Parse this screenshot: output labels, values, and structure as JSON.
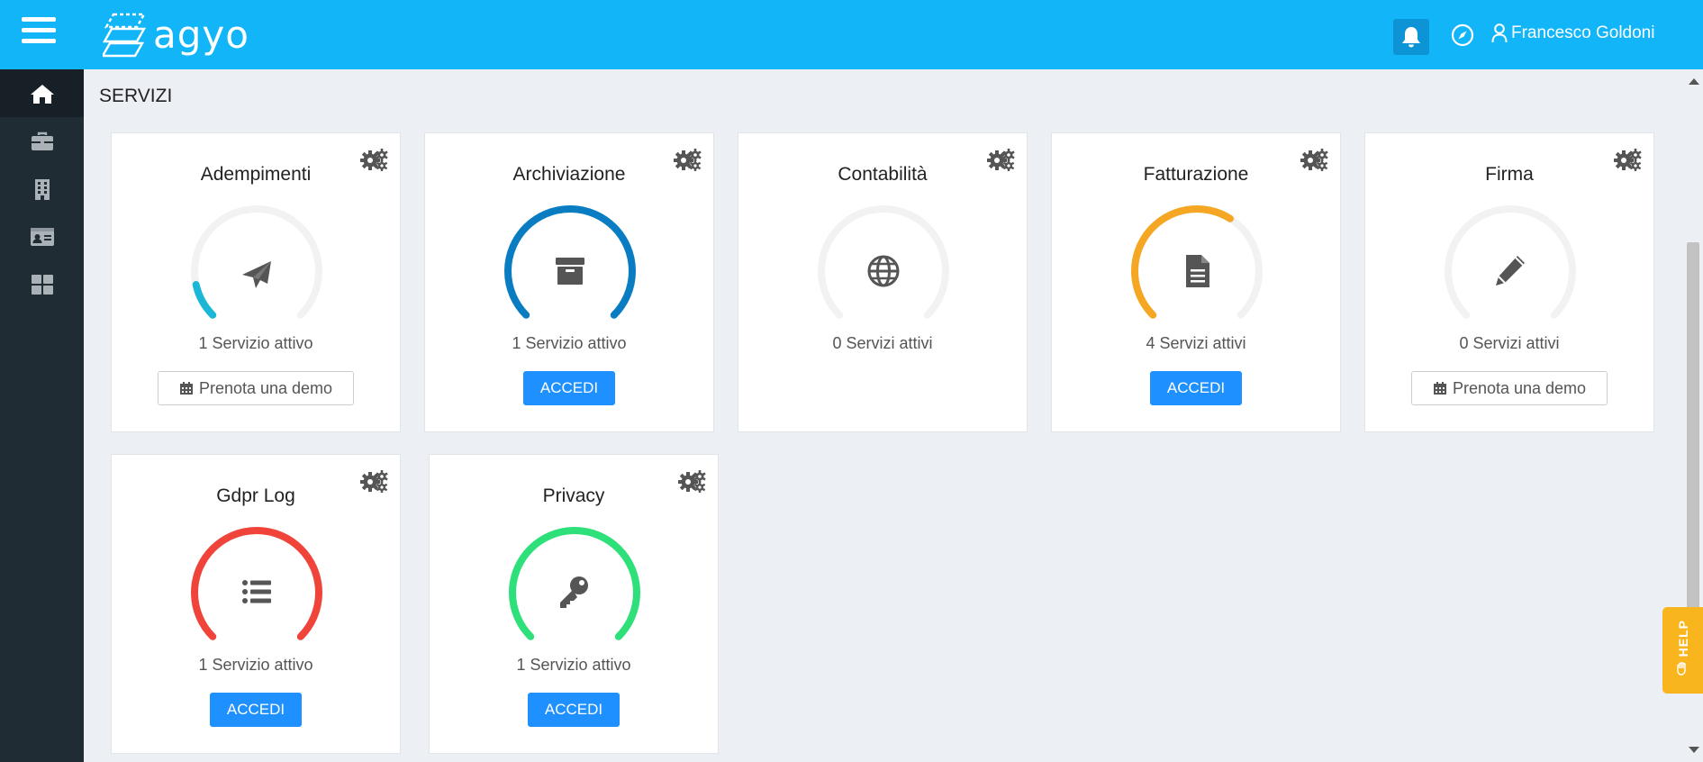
{
  "header": {
    "logo_text": "agyo",
    "user_name": "Francesco Goldoni"
  },
  "sidebar": {
    "items": [
      {
        "icon": "home-icon",
        "active": true
      },
      {
        "icon": "briefcase-icon"
      },
      {
        "icon": "building-icon"
      },
      {
        "icon": "id-card-icon"
      },
      {
        "icon": "grid-icon"
      }
    ]
  },
  "section_title": "SERVIZI",
  "services": [
    {
      "title": "Adempimenti",
      "count": "1 Servizio attivo",
      "button": "Prenota una demo",
      "button_type": "demo",
      "icon": "paper-plane-icon",
      "color": "#1ab8d6",
      "progress": 0.12
    },
    {
      "title": "Archiviazione",
      "count": "1 Servizio attivo",
      "button": "ACCEDI",
      "button_type": "accedi",
      "icon": "archive-box-icon",
      "color": "#0a7dc2",
      "progress": 1.0
    },
    {
      "title": "Contabilità",
      "count": "0 Servizi attivi",
      "button": "",
      "button_type": "none",
      "icon": "globe-icon",
      "color": "#f2f2f2",
      "progress": 0.0
    },
    {
      "title": "Fatturazione",
      "count": "4 Servizi attivi",
      "button": "ACCEDI",
      "button_type": "accedi",
      "icon": "document-icon",
      "color": "#f5a623",
      "progress": 0.62
    },
    {
      "title": "Firma",
      "count": "0 Servizi attivi",
      "button": "Prenota una demo",
      "button_type": "demo",
      "icon": "pencil-icon",
      "color": "#f2f2f2",
      "progress": 0.0
    },
    {
      "title": "Gdpr Log",
      "count": "1 Servizio attivo",
      "button": "ACCEDI",
      "button_type": "accedi",
      "icon": "list-icon",
      "color": "#f0443a",
      "progress": 1.0
    },
    {
      "title": "Privacy",
      "count": "1 Servizio attivo",
      "button": "ACCEDI",
      "button_type": "accedi",
      "icon": "key-icon",
      "color": "#2ee079",
      "progress": 1.0
    }
  ],
  "help": {
    "label": "HELP"
  }
}
